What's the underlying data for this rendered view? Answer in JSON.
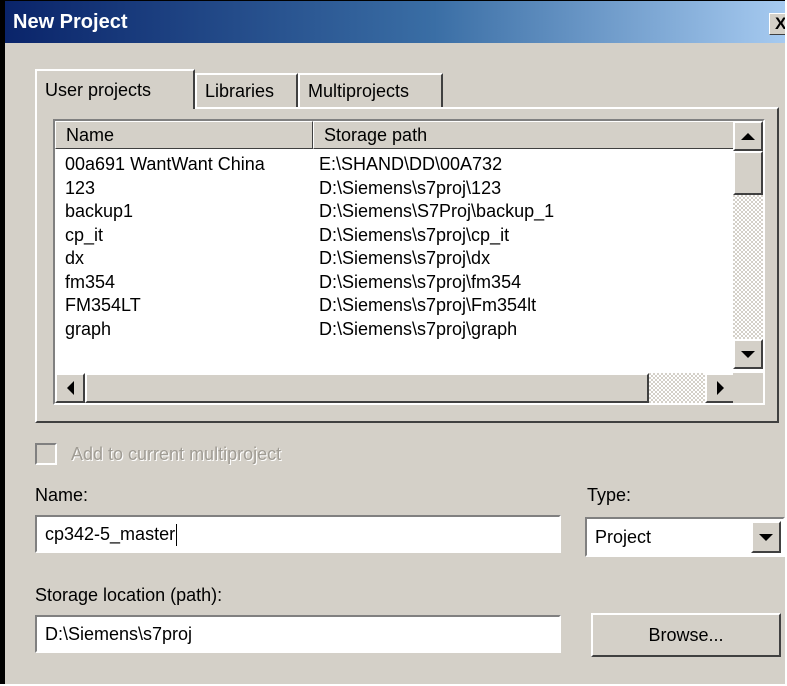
{
  "window": {
    "title": "New Project",
    "close_glyph": "X"
  },
  "tabs": [
    {
      "label": "User projects",
      "active": true
    },
    {
      "label": "Libraries",
      "active": false
    },
    {
      "label": "Multiprojects",
      "active": false
    }
  ],
  "list": {
    "columns": [
      "Name",
      "Storage path"
    ],
    "rows": [
      {
        "name": "00a691 WantWant China",
        "path": "E:\\SHAND\\DD\\00A732"
      },
      {
        "name": "123",
        "path": "D:\\Siemens\\s7proj\\123"
      },
      {
        "name": "backup1",
        "path": "D:\\Siemens\\S7Proj\\backup_1"
      },
      {
        "name": "cp_it",
        "path": "D:\\Siemens\\s7proj\\cp_it"
      },
      {
        "name": "dx",
        "path": "D:\\Siemens\\s7proj\\dx"
      },
      {
        "name": "fm354",
        "path": "D:\\Siemens\\s7proj\\fm354"
      },
      {
        "name": "FM354LT",
        "path": "D:\\Siemens\\s7proj\\Fm354lt"
      },
      {
        "name": "graph",
        "path": "D:\\Siemens\\s7proj\\graph"
      }
    ]
  },
  "checkbox": {
    "label": "Add to current multiproject",
    "checked": false,
    "enabled": false
  },
  "name_field": {
    "label": "Name:",
    "value": "cp342-5_master"
  },
  "type_field": {
    "label": "Type:",
    "value": "Project"
  },
  "storage_field": {
    "label": "Storage location (path):",
    "value": "D:\\Siemens\\s7proj"
  },
  "browse_button": {
    "label": "Browse..."
  },
  "icons": [
    "close-icon",
    "scroll-up-icon",
    "scroll-down-icon",
    "scroll-left-icon",
    "scroll-right-icon",
    "dropdown-arrow-icon"
  ],
  "colors": {
    "titlebar_start": "#0a246a",
    "titlebar_end": "#a6caf0",
    "face": "#d4d0c8"
  }
}
